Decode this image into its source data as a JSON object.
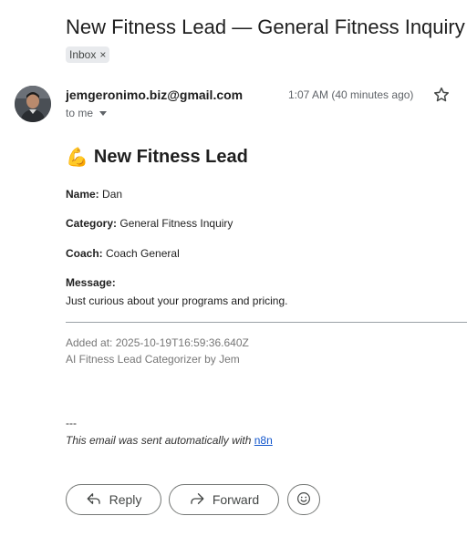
{
  "email": {
    "subject": "New Fitness Lead — General Fitness Inquiry",
    "label": "Inbox",
    "label_remove": "×",
    "sender": "jemgeronimo.biz@gmail.com",
    "to": "to me",
    "time": "1:07 AM (40 minutes ago)"
  },
  "content": {
    "heading_emoji": "💪",
    "heading": "New Fitness Lead",
    "name_label": "Name:",
    "name_value": "Dan",
    "category_label": "Category:",
    "category_value": "General Fitness Inquiry",
    "coach_label": "Coach:",
    "coach_value": "Coach General",
    "message_label": "Message:",
    "message_value": "Just curious about your programs and pricing.",
    "added_at": "Added at: 2025-10-19T16:59:36.640Z",
    "signature": "AI Fitness Lead Categorizer by Jem",
    "separator": "---",
    "auto_text": "This email was sent automatically with ",
    "auto_link": "n8n"
  },
  "actions": {
    "reply": "Reply",
    "forward": "Forward"
  },
  "icons": {
    "star": "star-outline-icon",
    "reply": "reply-arrow-icon",
    "forward": "forward-arrow-icon",
    "emoji": "emoji-smile-icon"
  }
}
